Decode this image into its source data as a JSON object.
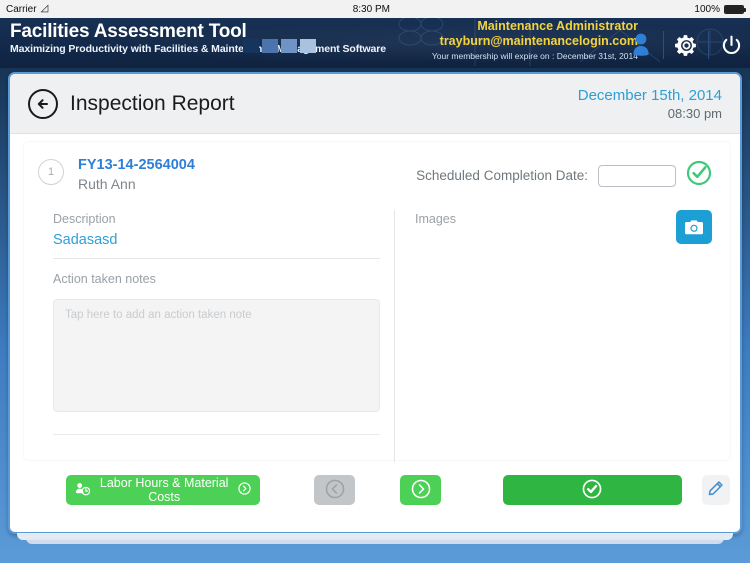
{
  "status_bar": {
    "carrier": "Carrier",
    "wifi_icon": "wifi-icon",
    "time": "8:30 PM",
    "battery_percent": "100%",
    "battery_icon": "battery-full-icon"
  },
  "app_header": {
    "brand_title": "Facilities Assessment Tool",
    "brand_subtitle": "Maximizing Productivity with Facilities & Maintenance Management Software",
    "logo_bar_colors": [
      "#16355e",
      "#4a74ab",
      "#6e93c4",
      "#a8c2e0"
    ],
    "account_name": "Maintenance Administrator",
    "account_email": "trayburn@maintenancelogin.com",
    "membership_notice": "Your membership will expire on : December 31st, 2014",
    "icons": {
      "user": "user-icon",
      "settings": "gear-icon",
      "power": "power-icon"
    },
    "colors": {
      "bar_background": "#13294a",
      "account_text": "#f5d33c"
    }
  },
  "title_bar": {
    "back_icon": "arrow-left-circle-icon",
    "title": "Inspection Report",
    "date": "December 15th, 2014",
    "time": "08:30 pm",
    "date_color": "#2e9fd4"
  },
  "record": {
    "sequence_number": "1",
    "work_order_id": "FY13-14-2564004",
    "contact_name": "Ruth Ann",
    "scheduled_label": "Scheduled Completion Date:",
    "scheduled_value": "",
    "scheduled_placeholder": "",
    "confirm_icon": "check-circle-icon",
    "confirm_color": "#3ec97a"
  },
  "details": {
    "description_label": "Description",
    "description_value": "Sadasasd",
    "notes_label": "Action taken notes",
    "notes_value": "",
    "notes_placeholder": "Tap here to add an action taken note"
  },
  "images": {
    "label": "Images",
    "camera_icon": "camera-icon",
    "camera_button_color": "#1b9fd4",
    "items": []
  },
  "toolbar": {
    "labor_label": "Labor Hours & Material Costs",
    "labor_leading_icon": "labor-person-clock-icon",
    "labor_trailing_icon": "chevron-right-circle-icon",
    "labor_color": "#4cd055",
    "prev_icon": "chevron-left-circle-icon",
    "prev_enabled": false,
    "prev_color": "#c3c6c8",
    "next_icon": "chevron-right-circle-icon",
    "next_color": "#4cd055",
    "complete_icon": "check-circle-filled-icon",
    "complete_color": "#2fb541",
    "edit_icon": "pencil-icon",
    "edit_color": "#3f8fd0"
  }
}
